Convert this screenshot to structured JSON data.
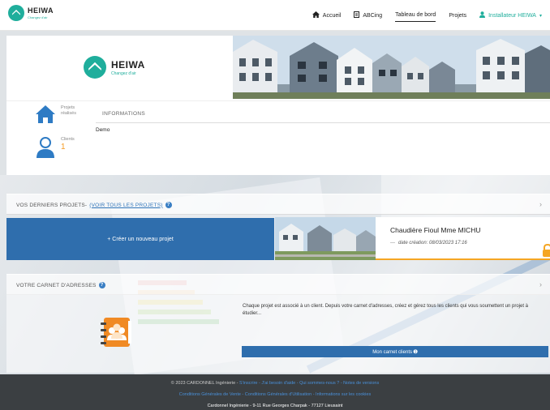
{
  "nav": {
    "brand": "HEIWA",
    "brand_tagline": "Changez d'air",
    "items": [
      {
        "label": "Accueil",
        "icon": "home-icon"
      },
      {
        "label": "ABCing",
        "icon": "document-icon"
      },
      {
        "label": "Tableau de bord",
        "icon": ""
      },
      {
        "label": "Projets",
        "icon": ""
      }
    ],
    "user_label": "Installateur HEIWA"
  },
  "header": {
    "brand": "HEIWA",
    "brand_tagline": "Changez d'air"
  },
  "stats": {
    "projects_label_1": "Projets",
    "projects_label_2": "réalisés",
    "clients_label": "Clients",
    "clients_value": "1"
  },
  "info": {
    "tab_label": "INFORMATIONS",
    "body": "Demo"
  },
  "projects_section": {
    "title": "VOS DERNIERS PROJETS",
    "separator": " - ",
    "link": "(VOIR TOUS LES PROJETS)",
    "create_button": "+ Créer un nouveau projet",
    "latest": {
      "title": "Chaudière Fioul Mme MICHU",
      "date_label": "date création:",
      "date_value": "08/03/2023 17:16"
    }
  },
  "address_section": {
    "title": "VOTRE CARNET D'ADRESSES",
    "description": "Chaque projet est associé à un client. Depuis votre carnet d'adresses, créez et gérez tous les clients qui vous soumettent un projet à étudier...",
    "button": "Mon carnet clients ➊"
  },
  "footer": {
    "copyright": "© 2023 CARDONNEL Ingénierie - ",
    "links_1": "S'inscrire - J'ai besoin d'aide - Qui sommes-nous ? - Notes de versions",
    "links_2": "Conditions Générales de Vente - Conditions Générales d'Utilisation - Informations sur les cookies",
    "address": "Cardonnel Ingénierie - 9-11 Rue Georges Charpak - 77127 Lieusaint"
  },
  "colors": {
    "brand_teal": "#1fae9c",
    "primary_blue": "#2f6ead",
    "accent_orange": "#f59a23"
  }
}
